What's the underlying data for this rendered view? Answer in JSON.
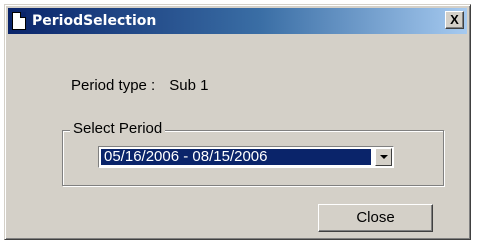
{
  "window": {
    "title": "PeriodSelection",
    "close_glyph": "X"
  },
  "period_type": {
    "label": "Period type :",
    "value": "Sub 1"
  },
  "select_period": {
    "group_label": "Select Period",
    "selected_value": "05/16/2006 - 08/15/2006"
  },
  "footer": {
    "close_label": "Close"
  },
  "colors": {
    "title_bar_start": "#0a246a",
    "title_bar_end": "#a6caf0",
    "window_bg": "#d4d0c8",
    "selection_bg": "#0a246a"
  },
  "icons": {
    "window_icon": "document-icon",
    "dropdown": "chevron-down-icon"
  }
}
